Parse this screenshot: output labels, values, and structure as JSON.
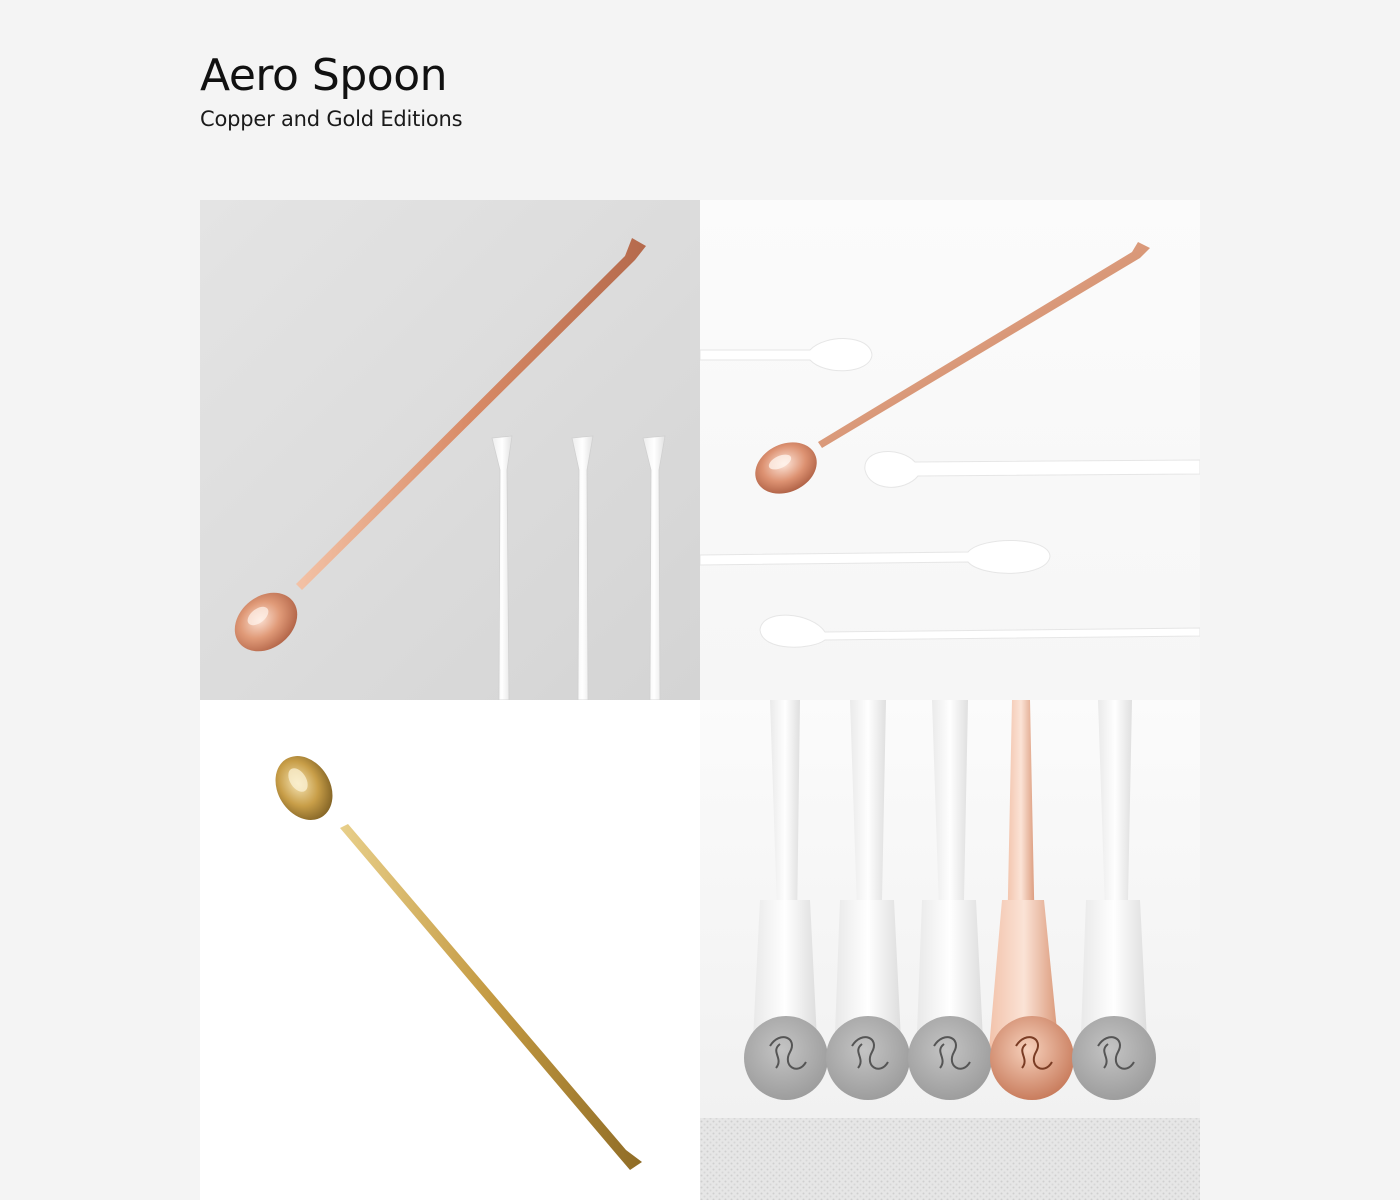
{
  "header": {
    "title": "Aero Spoon",
    "subtitle": "Copper and Gold Editions"
  },
  "gallery": {
    "photos": [
      {
        "subject": "copper-spoon-with-white-stirrers",
        "background": "#dcdcdc"
      },
      {
        "subject": "copper-spoon-with-spoon-cutouts",
        "background": "#fafafa"
      },
      {
        "subject": "gold-spoon",
        "background": "#ffffff"
      },
      {
        "subject": "spoon-ends-with-embossed-logo",
        "background": "#f6f6f6"
      }
    ],
    "colors": {
      "copper": "#e2a080",
      "gold": "#c9a24a",
      "white_stirrer": "#ffffff",
      "emboss_gray": "#9a9a9a"
    }
  }
}
